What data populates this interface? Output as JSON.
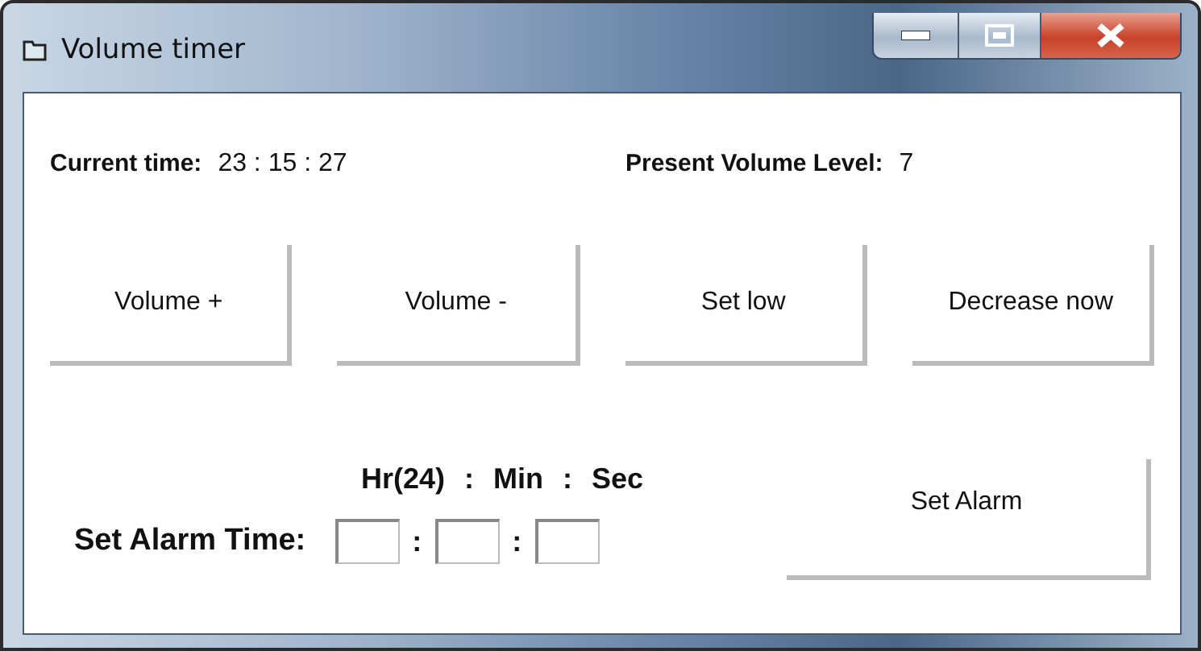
{
  "window": {
    "title": "Volume timer"
  },
  "info": [
    {
      "label": "Current time:",
      "value": "23 : 15 : 27"
    },
    {
      "label": "Present Volume Level:",
      "value": "7"
    }
  ],
  "buttons": [
    "Volume +",
    "Volume -",
    "Set low",
    "Decrease now"
  ],
  "alarm": {
    "headings": [
      "Hr(24)",
      ":",
      "Min",
      ":",
      "Sec"
    ],
    "label": "Set Alarm Time:",
    "separators": [
      ":",
      ":"
    ],
    "button": "Set Alarm"
  }
}
